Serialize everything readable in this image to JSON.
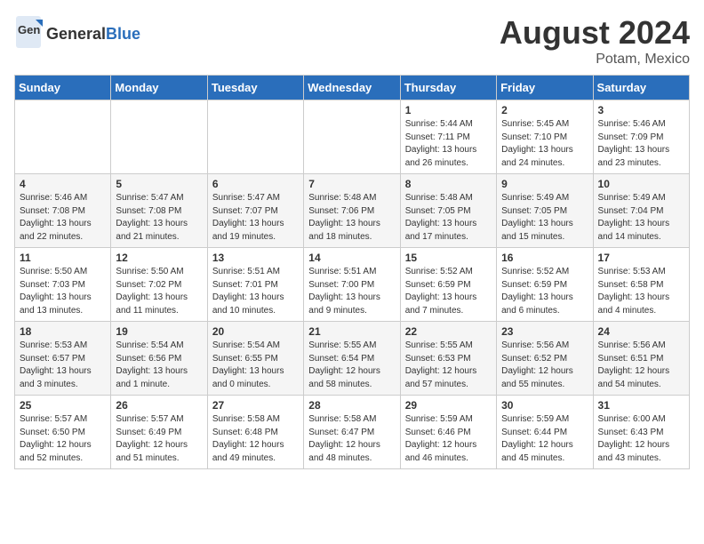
{
  "header": {
    "logo_general": "General",
    "logo_blue": "Blue",
    "title": "August 2024",
    "subtitle": "Potam, Mexico"
  },
  "days_of_week": [
    "Sunday",
    "Monday",
    "Tuesday",
    "Wednesday",
    "Thursday",
    "Friday",
    "Saturday"
  ],
  "weeks": [
    [
      {
        "day": "",
        "info": ""
      },
      {
        "day": "",
        "info": ""
      },
      {
        "day": "",
        "info": ""
      },
      {
        "day": "",
        "info": ""
      },
      {
        "day": "1",
        "info": "Sunrise: 5:44 AM\nSunset: 7:11 PM\nDaylight: 13 hours\nand 26 minutes."
      },
      {
        "day": "2",
        "info": "Sunrise: 5:45 AM\nSunset: 7:10 PM\nDaylight: 13 hours\nand 24 minutes."
      },
      {
        "day": "3",
        "info": "Sunrise: 5:46 AM\nSunset: 7:09 PM\nDaylight: 13 hours\nand 23 minutes."
      }
    ],
    [
      {
        "day": "4",
        "info": "Sunrise: 5:46 AM\nSunset: 7:08 PM\nDaylight: 13 hours\nand 22 minutes."
      },
      {
        "day": "5",
        "info": "Sunrise: 5:47 AM\nSunset: 7:08 PM\nDaylight: 13 hours\nand 21 minutes."
      },
      {
        "day": "6",
        "info": "Sunrise: 5:47 AM\nSunset: 7:07 PM\nDaylight: 13 hours\nand 19 minutes."
      },
      {
        "day": "7",
        "info": "Sunrise: 5:48 AM\nSunset: 7:06 PM\nDaylight: 13 hours\nand 18 minutes."
      },
      {
        "day": "8",
        "info": "Sunrise: 5:48 AM\nSunset: 7:05 PM\nDaylight: 13 hours\nand 17 minutes."
      },
      {
        "day": "9",
        "info": "Sunrise: 5:49 AM\nSunset: 7:05 PM\nDaylight: 13 hours\nand 15 minutes."
      },
      {
        "day": "10",
        "info": "Sunrise: 5:49 AM\nSunset: 7:04 PM\nDaylight: 13 hours\nand 14 minutes."
      }
    ],
    [
      {
        "day": "11",
        "info": "Sunrise: 5:50 AM\nSunset: 7:03 PM\nDaylight: 13 hours\nand 13 minutes."
      },
      {
        "day": "12",
        "info": "Sunrise: 5:50 AM\nSunset: 7:02 PM\nDaylight: 13 hours\nand 11 minutes."
      },
      {
        "day": "13",
        "info": "Sunrise: 5:51 AM\nSunset: 7:01 PM\nDaylight: 13 hours\nand 10 minutes."
      },
      {
        "day": "14",
        "info": "Sunrise: 5:51 AM\nSunset: 7:00 PM\nDaylight: 13 hours\nand 9 minutes."
      },
      {
        "day": "15",
        "info": "Sunrise: 5:52 AM\nSunset: 6:59 PM\nDaylight: 13 hours\nand 7 minutes."
      },
      {
        "day": "16",
        "info": "Sunrise: 5:52 AM\nSunset: 6:59 PM\nDaylight: 13 hours\nand 6 minutes."
      },
      {
        "day": "17",
        "info": "Sunrise: 5:53 AM\nSunset: 6:58 PM\nDaylight: 13 hours\nand 4 minutes."
      }
    ],
    [
      {
        "day": "18",
        "info": "Sunrise: 5:53 AM\nSunset: 6:57 PM\nDaylight: 13 hours\nand 3 minutes."
      },
      {
        "day": "19",
        "info": "Sunrise: 5:54 AM\nSunset: 6:56 PM\nDaylight: 13 hours\nand 1 minute."
      },
      {
        "day": "20",
        "info": "Sunrise: 5:54 AM\nSunset: 6:55 PM\nDaylight: 13 hours\nand 0 minutes."
      },
      {
        "day": "21",
        "info": "Sunrise: 5:55 AM\nSunset: 6:54 PM\nDaylight: 12 hours\nand 58 minutes."
      },
      {
        "day": "22",
        "info": "Sunrise: 5:55 AM\nSunset: 6:53 PM\nDaylight: 12 hours\nand 57 minutes."
      },
      {
        "day": "23",
        "info": "Sunrise: 5:56 AM\nSunset: 6:52 PM\nDaylight: 12 hours\nand 55 minutes."
      },
      {
        "day": "24",
        "info": "Sunrise: 5:56 AM\nSunset: 6:51 PM\nDaylight: 12 hours\nand 54 minutes."
      }
    ],
    [
      {
        "day": "25",
        "info": "Sunrise: 5:57 AM\nSunset: 6:50 PM\nDaylight: 12 hours\nand 52 minutes."
      },
      {
        "day": "26",
        "info": "Sunrise: 5:57 AM\nSunset: 6:49 PM\nDaylight: 12 hours\nand 51 minutes."
      },
      {
        "day": "27",
        "info": "Sunrise: 5:58 AM\nSunset: 6:48 PM\nDaylight: 12 hours\nand 49 minutes."
      },
      {
        "day": "28",
        "info": "Sunrise: 5:58 AM\nSunset: 6:47 PM\nDaylight: 12 hours\nand 48 minutes."
      },
      {
        "day": "29",
        "info": "Sunrise: 5:59 AM\nSunset: 6:46 PM\nDaylight: 12 hours\nand 46 minutes."
      },
      {
        "day": "30",
        "info": "Sunrise: 5:59 AM\nSunset: 6:44 PM\nDaylight: 12 hours\nand 45 minutes."
      },
      {
        "day": "31",
        "info": "Sunrise: 6:00 AM\nSunset: 6:43 PM\nDaylight: 12 hours\nand 43 minutes."
      }
    ]
  ]
}
